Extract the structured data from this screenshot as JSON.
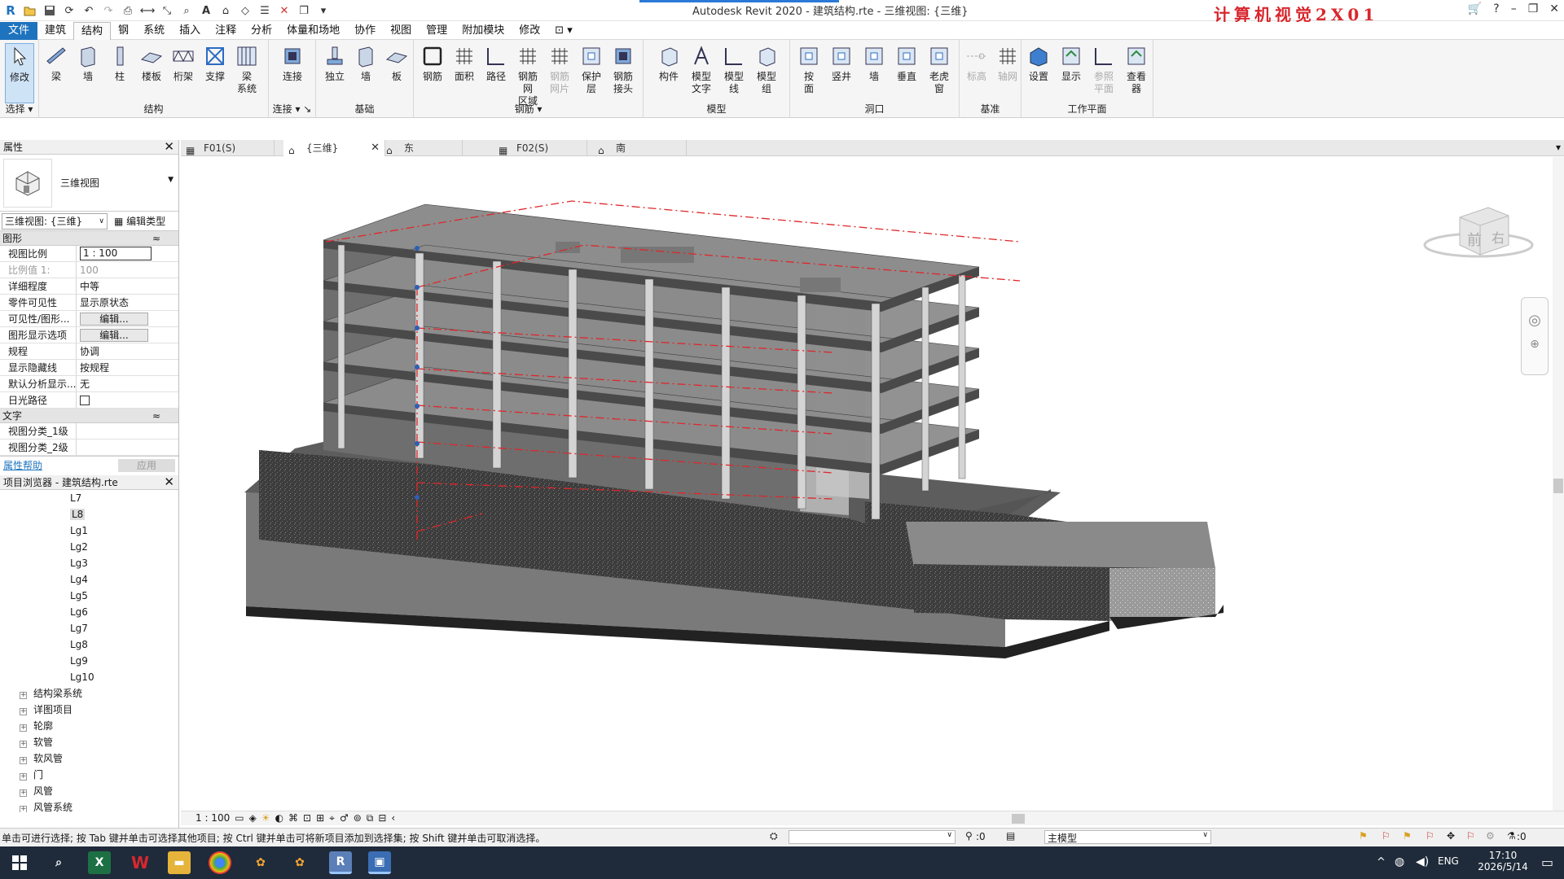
{
  "app": {
    "title": "Autodesk Revit 2020 - 建筑结构.rte - 三维视图: {三维}",
    "brand_text": "计算机视觉2X01"
  },
  "menu": [
    "文件",
    "建筑",
    "结构",
    "钢",
    "系统",
    "插入",
    "注释",
    "分析",
    "体量和场地",
    "协作",
    "视图",
    "管理",
    "附加模块",
    "修改"
  ],
  "ribbon": {
    "select": {
      "modify": "修改",
      "group": "选择"
    },
    "structure": {
      "items": [
        "梁",
        "墙",
        "柱",
        "楼板",
        "桁架",
        "支撑",
        "梁\n系统"
      ],
      "group": "结构"
    },
    "connection": {
      "items": [
        "连接"
      ],
      "group": "连接"
    },
    "foundation": {
      "items": [
        "独立",
        "墙",
        "板"
      ],
      "group": "基础"
    },
    "rebar": {
      "items": [
        "钢筋",
        "面积",
        "路径",
        "钢筋网\n区域",
        "钢筋\n网片",
        "保护层",
        "钢筋\n接头"
      ],
      "group": "钢筋"
    },
    "model": {
      "items": [
        "构件",
        "模型\n文字",
        "模型\n线",
        "模型\n组"
      ],
      "group": "模型"
    },
    "opening": {
      "items": [
        "按\n面",
        "竖井",
        "墙",
        "垂直",
        "老虎窗"
      ],
      "group": "洞口"
    },
    "datum": {
      "items": [
        "标高",
        "轴网"
      ],
      "group": "基准"
    },
    "workplane": {
      "items": [
        "设置",
        "显示",
        "参照\n平面",
        "查看器"
      ],
      "group": "工作平面"
    }
  },
  "tabs": [
    {
      "label": "F01(S)",
      "active": false
    },
    {
      "label": "{三维}",
      "active": true
    },
    {
      "label": "东",
      "active": false
    },
    {
      "label": "F02(S)",
      "active": false
    },
    {
      "label": "南",
      "active": false
    }
  ],
  "properties": {
    "title": "属性",
    "type_name": "三维视图",
    "selector": "三维视图: {三维}",
    "edit_type": "编辑类型",
    "section_graphics": "图形",
    "rows": [
      {
        "k": "视图比例",
        "v": "1 : 100",
        "kind": "input"
      },
      {
        "k": "比例值 1:",
        "v": "100",
        "kind": "dim"
      },
      {
        "k": "详细程度",
        "v": "中等",
        "kind": "text"
      },
      {
        "k": "零件可见性",
        "v": "显示原状态",
        "kind": "text"
      },
      {
        "k": "可见性/图形...",
        "v": "编辑...",
        "kind": "button"
      },
      {
        "k": "图形显示选项",
        "v": "编辑...",
        "kind": "button"
      },
      {
        "k": "规程",
        "v": "协调",
        "kind": "text"
      },
      {
        "k": "显示隐藏线",
        "v": "按规程",
        "kind": "text"
      },
      {
        "k": "默认分析显示...",
        "v": "无",
        "kind": "text"
      },
      {
        "k": "日光路径",
        "v": "",
        "kind": "check"
      }
    ],
    "section_text": "文字",
    "rows2": [
      {
        "k": "视图分类_1级",
        "v": ""
      },
      {
        "k": "视图分类_2级",
        "v": ""
      }
    ],
    "help": "属性帮助",
    "apply": "应用"
  },
  "browser": {
    "title": "项目浏览器 - 建筑结构.rte",
    "levels": [
      "L7",
      "L8",
      "Lg1",
      "Lg2",
      "Lg3",
      "Lg4",
      "Lg5",
      "Lg6",
      "Lg7",
      "Lg8",
      "Lg9",
      "Lg10"
    ],
    "selected": "L8",
    "groups": [
      "结构梁系统",
      "详图项目",
      "轮廓",
      "软管",
      "软风管",
      "门",
      "风管",
      "风管系统"
    ]
  },
  "viewcube": {
    "front": "前",
    "right": "右"
  },
  "view_control": {
    "scale": "1 : 100"
  },
  "status": {
    "message": "单击可进行选择; 按 Tab 键并单击可选择其他项目; 按 Ctrl 键并单击可将新项目添加到选择集; 按 Shift 键并单击可取消选择。",
    "count": ":0",
    "model": "主模型",
    "filter": ":0"
  },
  "taskbar": {
    "lang": "ENG",
    "time": "17:10",
    "date": "2026/5/14"
  },
  "colors": {
    "accent": "#1e73be",
    "brand": "#d8272d",
    "grid_line": "#e0262a"
  }
}
